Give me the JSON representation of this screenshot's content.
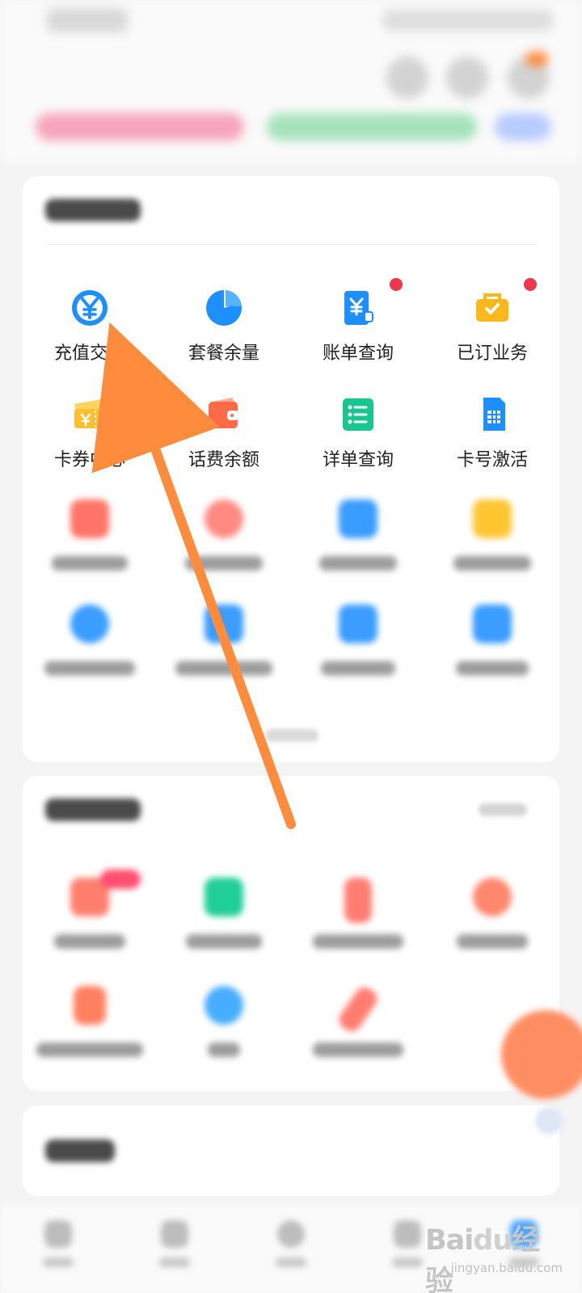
{
  "services": {
    "visible_items": [
      {
        "label": "充值交费",
        "icon": "recharge-icon",
        "color": "#1f8fff",
        "dot": false
      },
      {
        "label": "套餐余量",
        "icon": "pie-chart-icon",
        "color": "#1f8fff",
        "dot": false
      },
      {
        "label": "账单查询",
        "icon": "bill-icon",
        "color": "#1f8fff",
        "dot": true
      },
      {
        "label": "已订业务",
        "icon": "briefcase-icon",
        "color": "#ffb11b",
        "dot": true
      },
      {
        "label": "卡券中心",
        "icon": "coupon-icon",
        "color": "#ffc13a",
        "dot": false
      },
      {
        "label": "话费余额",
        "icon": "wallet-icon",
        "color": "#ff6b4a",
        "dot": false
      },
      {
        "label": "详单查询",
        "icon": "list-icon",
        "color": "#18c98d",
        "dot": false
      },
      {
        "label": "卡号激活",
        "icon": "sim-card-icon",
        "color": "#1f8fff",
        "dot": false
      }
    ]
  },
  "annotation": {
    "arrow_color": "#ff8c3c"
  },
  "watermark": {
    "main_left": "Bai",
    "main_mid": "du",
    "main_right": "经验",
    "sub": "jingyan.baidu.com"
  }
}
